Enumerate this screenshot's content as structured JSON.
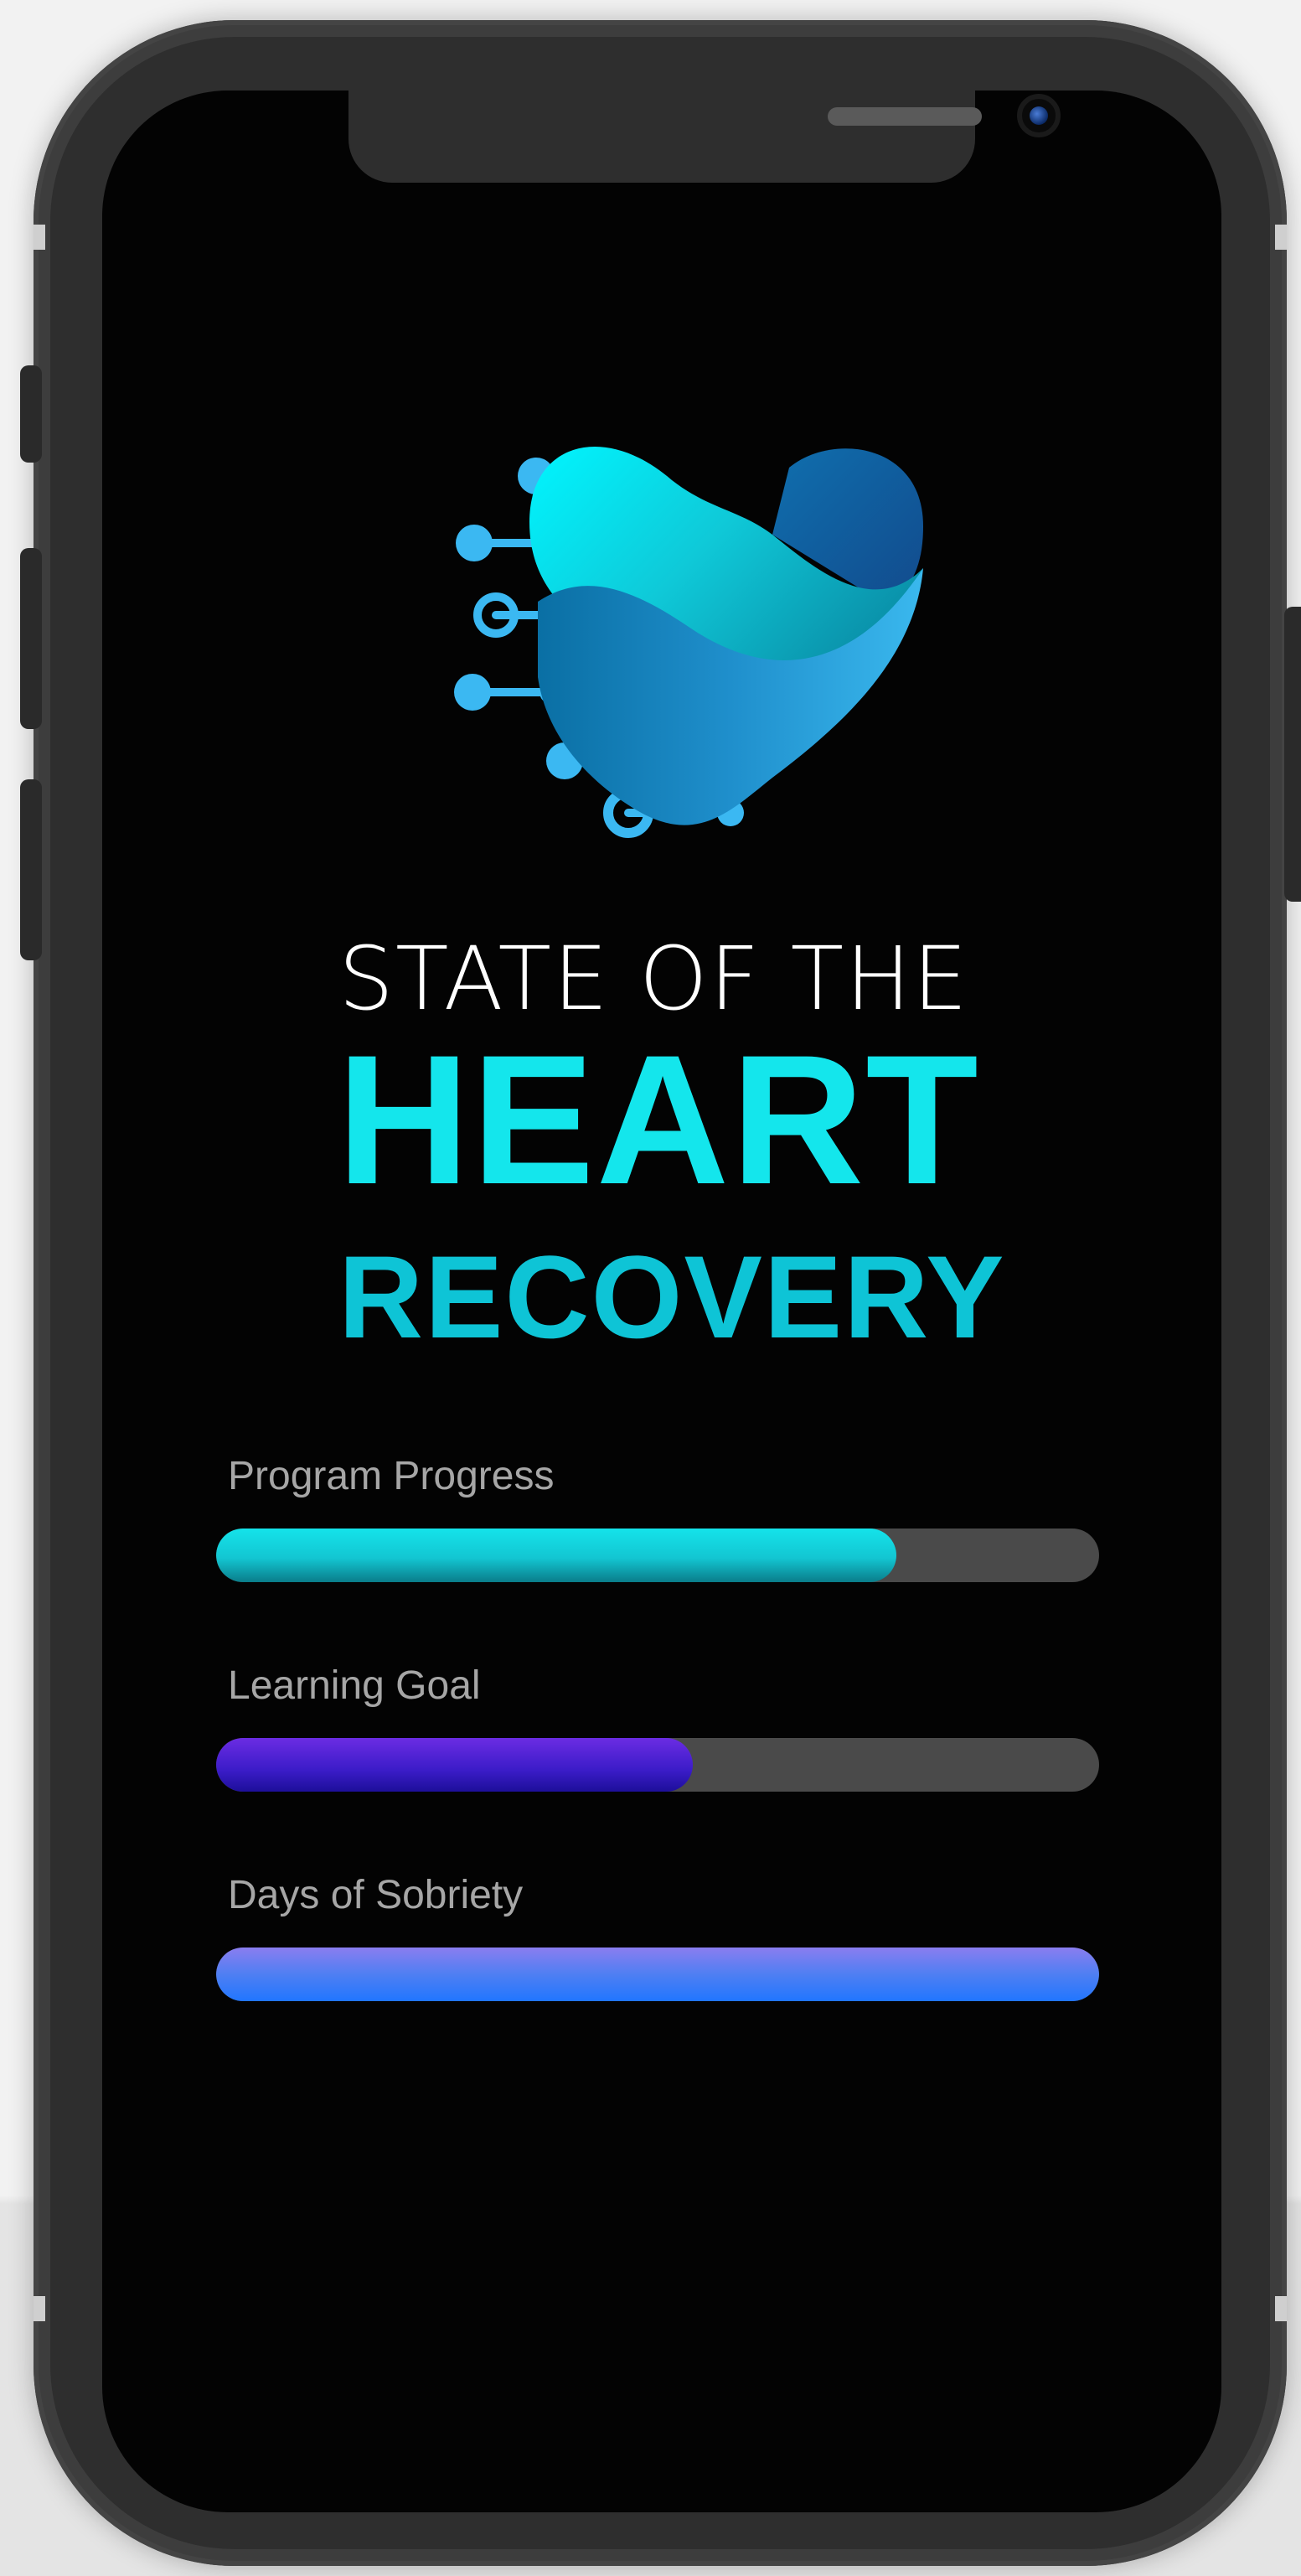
{
  "title": {
    "line1": "STATE OF THE",
    "line2": "HEART",
    "line3": "RECOVERY"
  },
  "metrics": [
    {
      "label": "Program Progress",
      "fraction": 0.77,
      "color": "#13c6d2"
    },
    {
      "label": "Learning Goal",
      "fraction": 0.54,
      "color": "#3b1cc8"
    },
    {
      "label": "Days of Sobriety",
      "fraction": 1.0,
      "color": "#2176ff"
    }
  ],
  "colors": {
    "accent": "#14e6ec",
    "accent_dark": "#0ec4d6",
    "track": "#4a4a4a",
    "screen": "#030303"
  },
  "icons": [
    "heart-circuit-logo-icon",
    "speaker-icon",
    "front-camera-icon"
  ]
}
